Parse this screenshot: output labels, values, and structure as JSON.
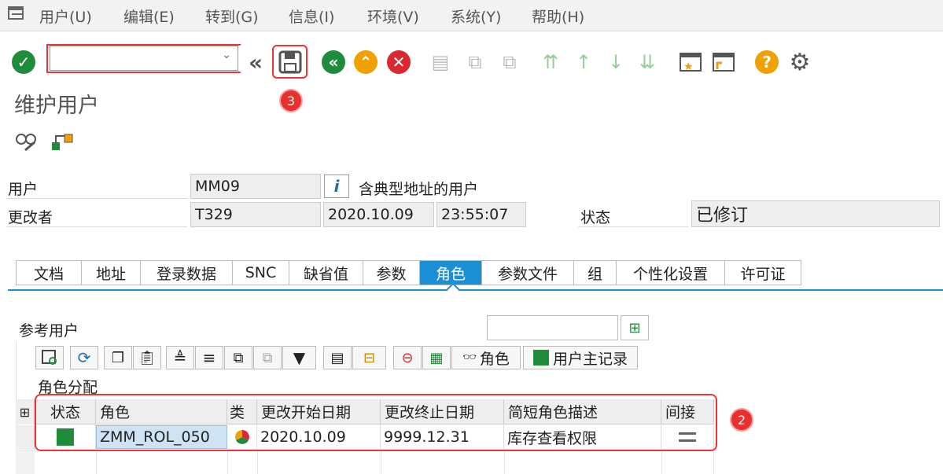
{
  "menu": [
    "用户(U)",
    "编辑(E)",
    "转到(G)",
    "信息(I)",
    "环境(V)",
    "系统(Y)",
    "帮助(H)"
  ],
  "title": "维护用户",
  "badges": {
    "b3": "3",
    "b2": "2"
  },
  "form": {
    "user_label": "用户",
    "user_value": "MM09",
    "user_desc": "含典型地址的用户",
    "changed_by_label": "更改者",
    "changed_by_value": "T329",
    "date": "2020.10.09",
    "time": "23:55:07",
    "status_label": "状态",
    "status_value": "已修订"
  },
  "tabs": [
    "文档",
    "地址",
    "登录数据",
    "SNC",
    "缺省值",
    "参数",
    "角色",
    "参数文件",
    "组",
    "个性化设置",
    "许可证"
  ],
  "active_tab": "角色",
  "ref_user_label": "参考用户",
  "grid_toolbar": {
    "role_btn": "角色",
    "master_btn": "用户主记录"
  },
  "section_title": "角色分配",
  "columns": [
    "状态",
    "角色",
    "类",
    "更改开始日期",
    "更改终止日期",
    "简短角色描述",
    "间接"
  ],
  "rows": [
    {
      "status_color": "#1e8c3a",
      "role": "ZMM_ROL_050",
      "start": "2020.10.09",
      "end": "9999.12.31",
      "desc": "库存查看权限"
    }
  ],
  "colors": {
    "accent": "#1a8fd4",
    "highlight": "#e33"
  }
}
